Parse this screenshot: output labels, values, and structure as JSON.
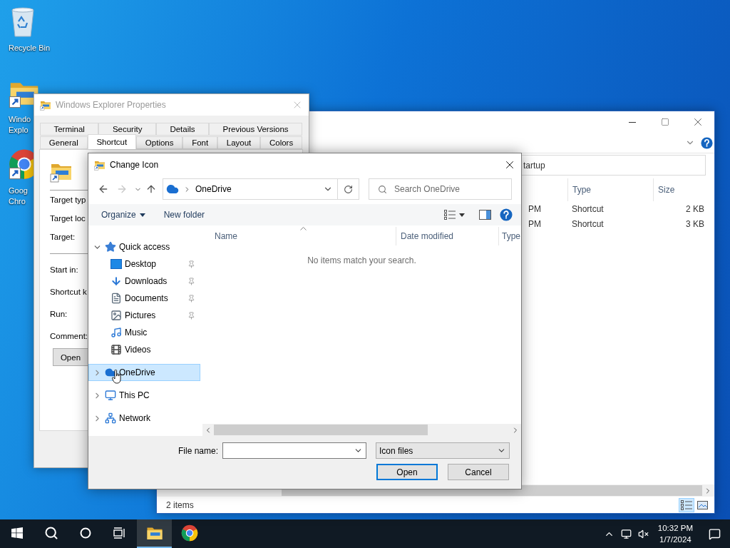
{
  "desktop_icons": [
    {
      "kind": "recycle-bin",
      "label_lines": [
        "Recycle Bin"
      ]
    },
    {
      "kind": "explorer",
      "label_lines": [
        "Windo",
        "Explo"
      ]
    },
    {
      "kind": "chrome",
      "label_lines": [
        "Goog",
        "Chro"
      ]
    }
  ],
  "explorer_window": {
    "address": "tartup",
    "columns": [
      "Type",
      "Size"
    ],
    "rows": [
      {
        "date": "PM",
        "type": "Shortcut",
        "size": "2 KB"
      },
      {
        "date": "PM",
        "type": "Shortcut",
        "size": "3 KB"
      }
    ],
    "status": "2 items"
  },
  "properties_window": {
    "title": "Windows Explorer Properties",
    "tab_rows": [
      [
        {
          "label": "Terminal",
          "selected": false
        },
        {
          "label": "Security",
          "selected": false
        },
        {
          "label": "Details",
          "selected": false
        },
        {
          "label": "Previous Versions",
          "selected": false
        }
      ],
      [
        {
          "label": "General",
          "selected": false
        },
        {
          "label": "Shortcut",
          "selected": true
        },
        {
          "label": "Options",
          "selected": false
        },
        {
          "label": "Font",
          "selected": false
        },
        {
          "label": "Layout",
          "selected": false
        },
        {
          "label": "Colors",
          "selected": false
        }
      ]
    ],
    "field_groups": [
      [
        "Target typ",
        "Target loc",
        "Target:"
      ],
      [
        "Start in:",
        "Shortcut k",
        "Run:",
        "Comment:"
      ]
    ],
    "button": "Open"
  },
  "dialog": {
    "title": "Change Icon",
    "forward_disabled": true,
    "address": "OneDrive",
    "search_placeholder": "Search OneDrive",
    "commands": [
      "Organize",
      "New folder"
    ],
    "tree": [
      {
        "label": "Quick access",
        "kind": "star",
        "expanded": true,
        "selected": false,
        "children": [
          {
            "label": "Desktop",
            "kind": "desktop",
            "pinned": true,
            "selected": false
          },
          {
            "label": "Downloads",
            "kind": "downloads",
            "pinned": true,
            "selected": false
          },
          {
            "label": "Documents",
            "kind": "documents",
            "pinned": true,
            "selected": false
          },
          {
            "label": "Pictures",
            "kind": "pictures",
            "pinned": true,
            "selected": false
          },
          {
            "label": "Music",
            "kind": "music",
            "pinned": false,
            "selected": false
          },
          {
            "label": "Videos",
            "kind": "videos",
            "pinned": false,
            "selected": false
          }
        ]
      },
      {
        "label": "OneDrive",
        "kind": "cloud",
        "expanded": false,
        "selected": true
      },
      {
        "label": "This PC",
        "kind": "pc",
        "expanded": false,
        "selected": false
      },
      {
        "label": "Network",
        "kind": "network",
        "expanded": false,
        "selected": false
      }
    ],
    "columns": [
      "Name",
      "Date modified",
      "Type"
    ],
    "empty_message": "No items match your search.",
    "file_name_label": "File name:",
    "file_type": "Icon files",
    "buttons": [
      {
        "label": "Open",
        "default": true
      },
      {
        "label": "Cancel",
        "default": false
      }
    ]
  },
  "taskbar": {
    "apps": [
      {
        "kind": "explorer",
        "active": true
      },
      {
        "kind": "chrome",
        "active": false
      }
    ],
    "time": "10:32 PM",
    "date": "1/7/2024"
  }
}
